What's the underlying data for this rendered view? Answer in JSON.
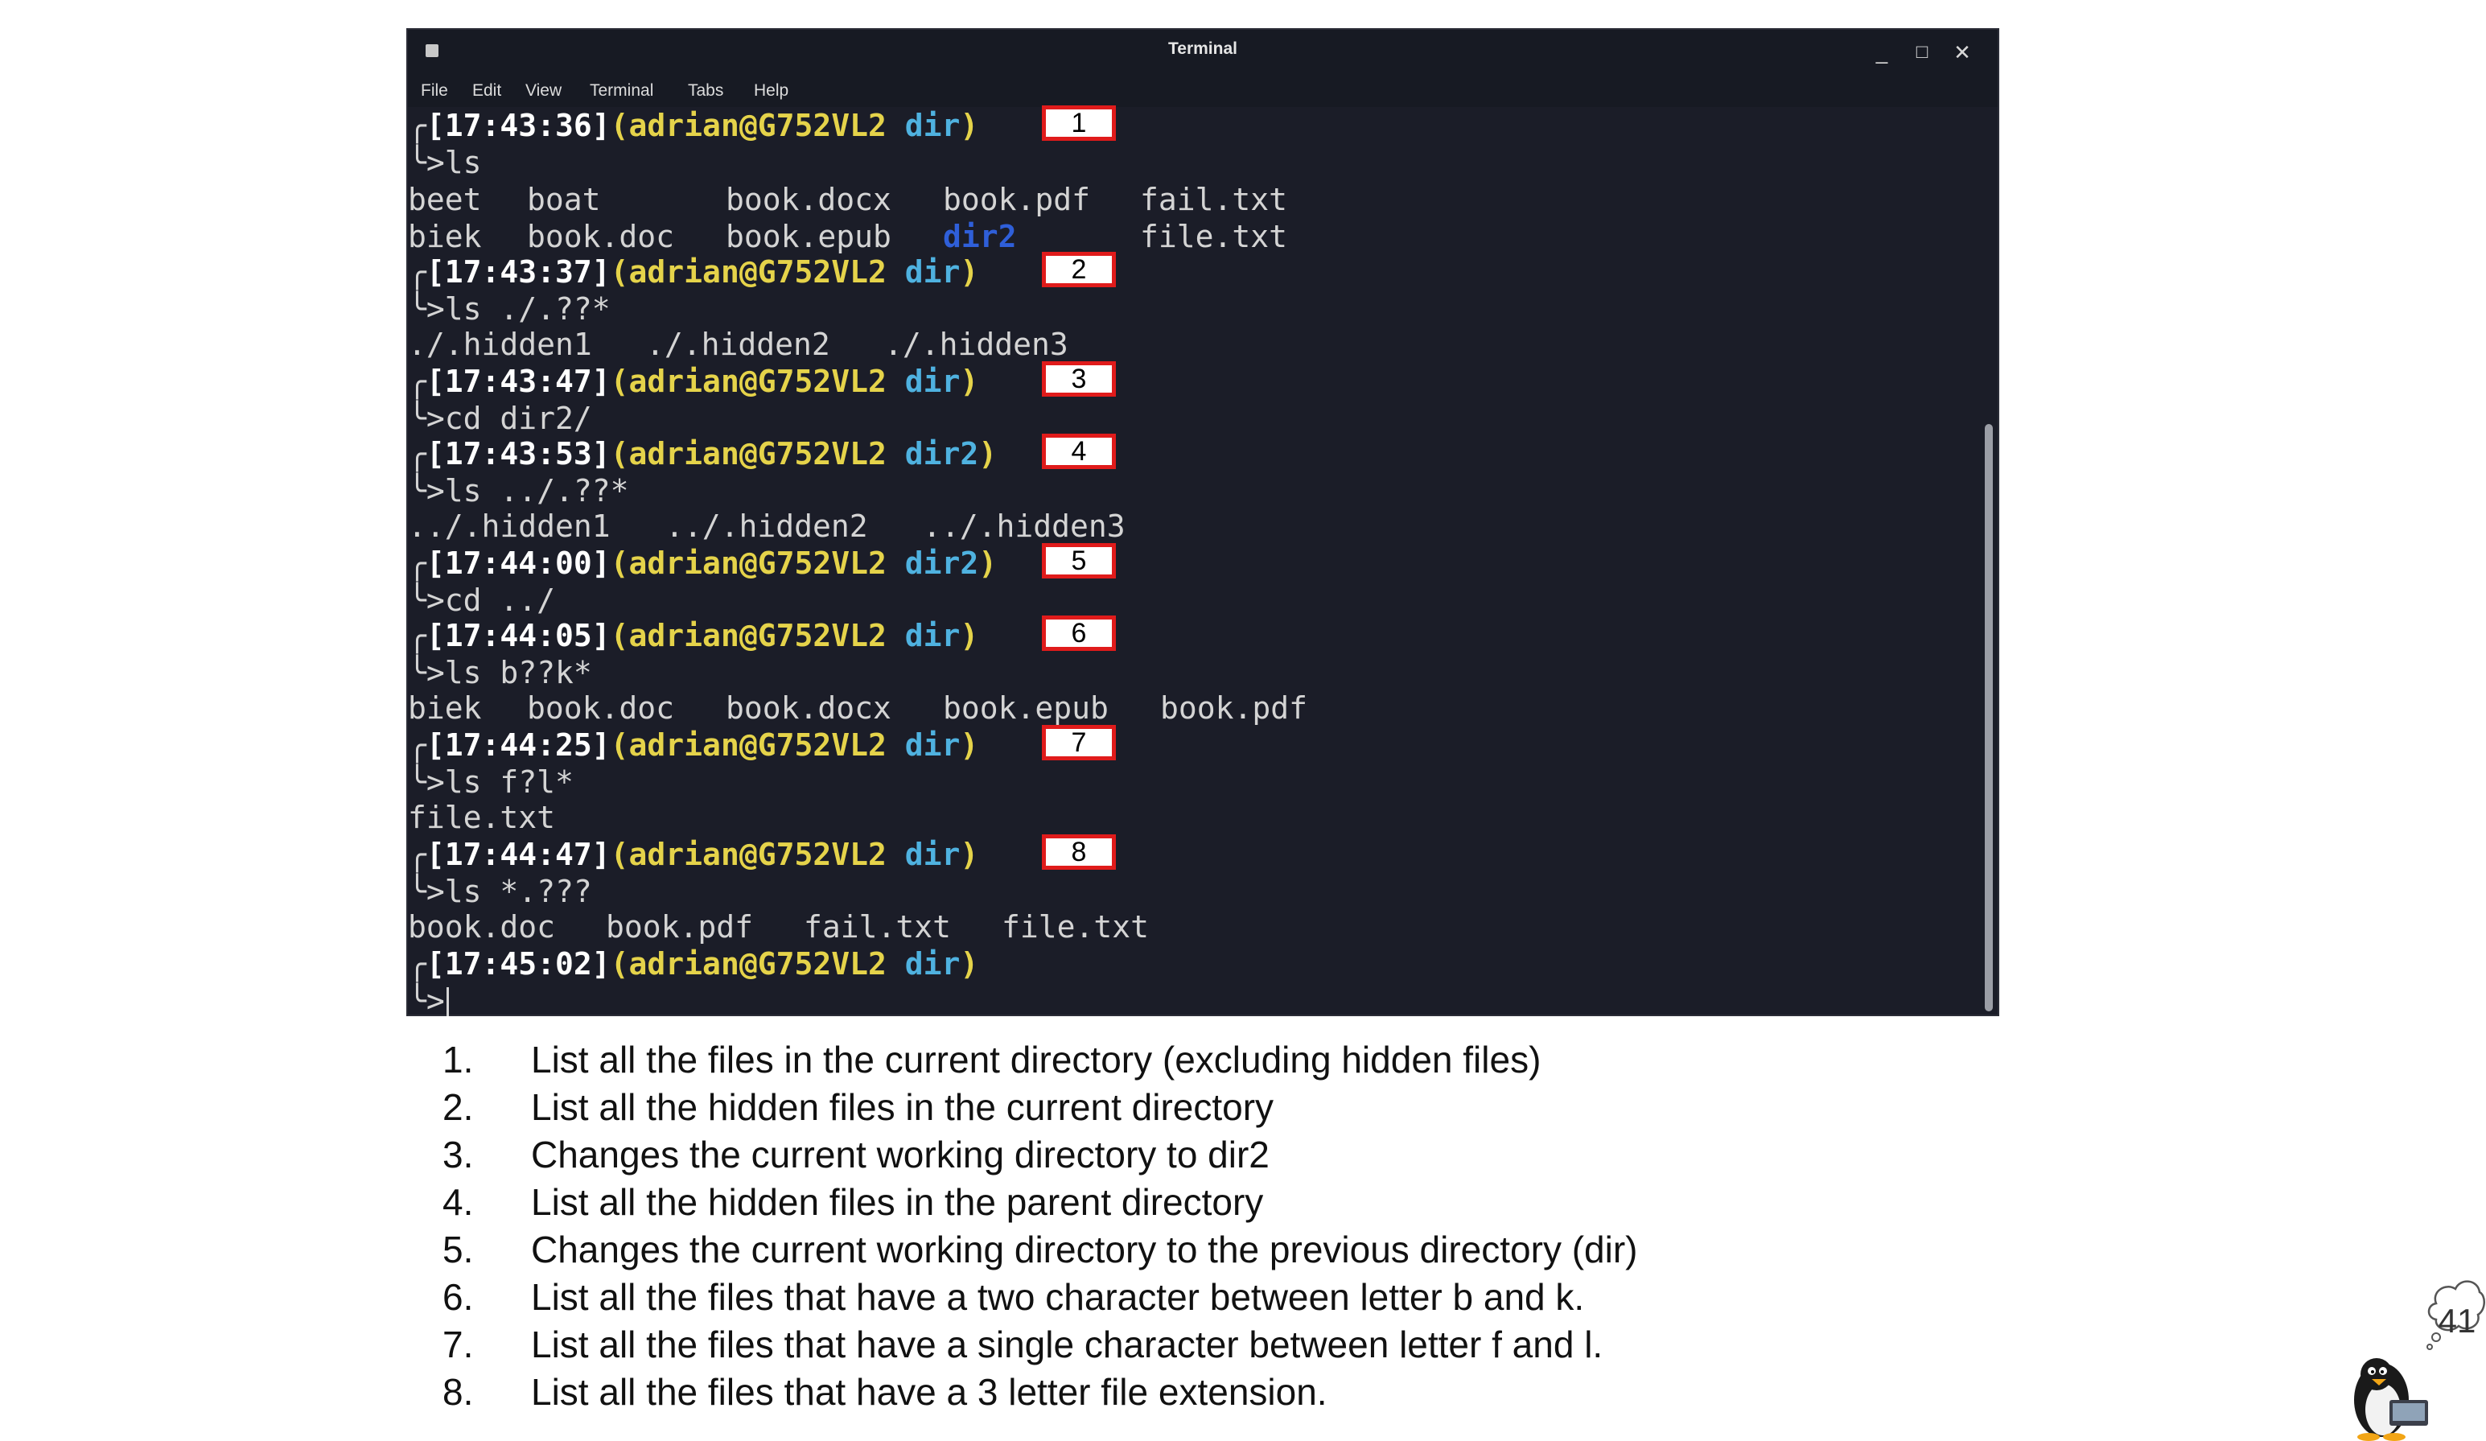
{
  "window": {
    "title": "Terminal",
    "menu": [
      "File",
      "Edit",
      "View",
      "Terminal",
      "Tabs",
      "Help"
    ],
    "controls": {
      "minimize": "_",
      "maximize": "□",
      "close": "✕"
    }
  },
  "prompts": [
    {
      "time": "[17:43:36]",
      "host": "(adrian@G752VL2",
      "cwd": "dir",
      "command": "ls",
      "callout": "1"
    },
    {
      "time": "[17:43:37]",
      "host": "(adrian@G752VL2",
      "cwd": "dir",
      "command": "ls ./.??*",
      "callout": "2"
    },
    {
      "time": "[17:43:47]",
      "host": "(adrian@G752VL2",
      "cwd": "dir",
      "command": "cd dir2/",
      "callout": "3"
    },
    {
      "time": "[17:43:53]",
      "host": "(adrian@G752VL2",
      "cwd": "dir2",
      "command": "ls ../.??*",
      "callout": "4"
    },
    {
      "time": "[17:44:00]",
      "host": "(adrian@G752VL2",
      "cwd": "dir2",
      "command": "cd ../",
      "callout": "5"
    },
    {
      "time": "[17:44:05]",
      "host": "(adrian@G752VL2",
      "cwd": "dir",
      "command": "ls b??k*",
      "callout": "6"
    },
    {
      "time": "[17:44:25]",
      "host": "(adrian@G752VL2",
      "cwd": "dir",
      "command": "ls f?l*",
      "callout": "7"
    },
    {
      "time": "[17:44:47]",
      "host": "(adrian@G752VL2",
      "cwd": "dir",
      "command": "ls *.???",
      "callout": "8"
    },
    {
      "time": "[17:45:02]",
      "host": "(adrian@G752VL2",
      "cwd": "dir",
      "command": "",
      "callout": ""
    }
  ],
  "outputs": {
    "ls_row1": [
      "beet",
      "boat",
      "book.docx",
      "book.pdf",
      "fail.txt"
    ],
    "ls_row2": [
      "biek",
      "book.doc",
      "book.epub",
      "dir2",
      "file.txt"
    ],
    "hidden_cwd": [
      "./.hidden1",
      "./.hidden2",
      "./.hidden3"
    ],
    "hidden_parent": [
      "../.hidden1",
      "../.hidden2",
      "../.hidden3"
    ],
    "bk_glob": [
      "biek",
      "book.doc",
      "book.docx",
      "book.epub",
      "book.pdf"
    ],
    "fl_glob": [
      "file.txt"
    ],
    "ext3_glob": [
      "book.doc",
      "book.pdf",
      "fail.txt",
      "file.txt"
    ]
  },
  "prompt_symbols": {
    "bend": "╰",
    "arrow": ">",
    "top": "╭"
  },
  "explanations": [
    {
      "num": "1.",
      "text": "List all the files in the current directory (excluding hidden files)"
    },
    {
      "num": "2.",
      "text": "List all the hidden files in the current directory"
    },
    {
      "num": "3.",
      "text": "Changes the current working directory to dir2"
    },
    {
      "num": "4.",
      "text": "List all the hidden files in the parent directory"
    },
    {
      "num": "5.",
      "text": "Changes the current working directory to the previous directory (dir)"
    },
    {
      "num": "6.",
      "text": "List all the files that have a two character between letter b and k."
    },
    {
      "num": "7.",
      "text": "List all the files that have a single character between letter f and l."
    },
    {
      "num": "8.",
      "text": "List all the files that have a 3 letter file extension."
    }
  ],
  "page_number": "41",
  "colors": {
    "callout_border": "#e01b1b",
    "host": "#e5d34a",
    "cwd": "#4fb2e0",
    "dir_highlight": "#2f5fd9",
    "terminal_bg": "#1b1d28"
  }
}
